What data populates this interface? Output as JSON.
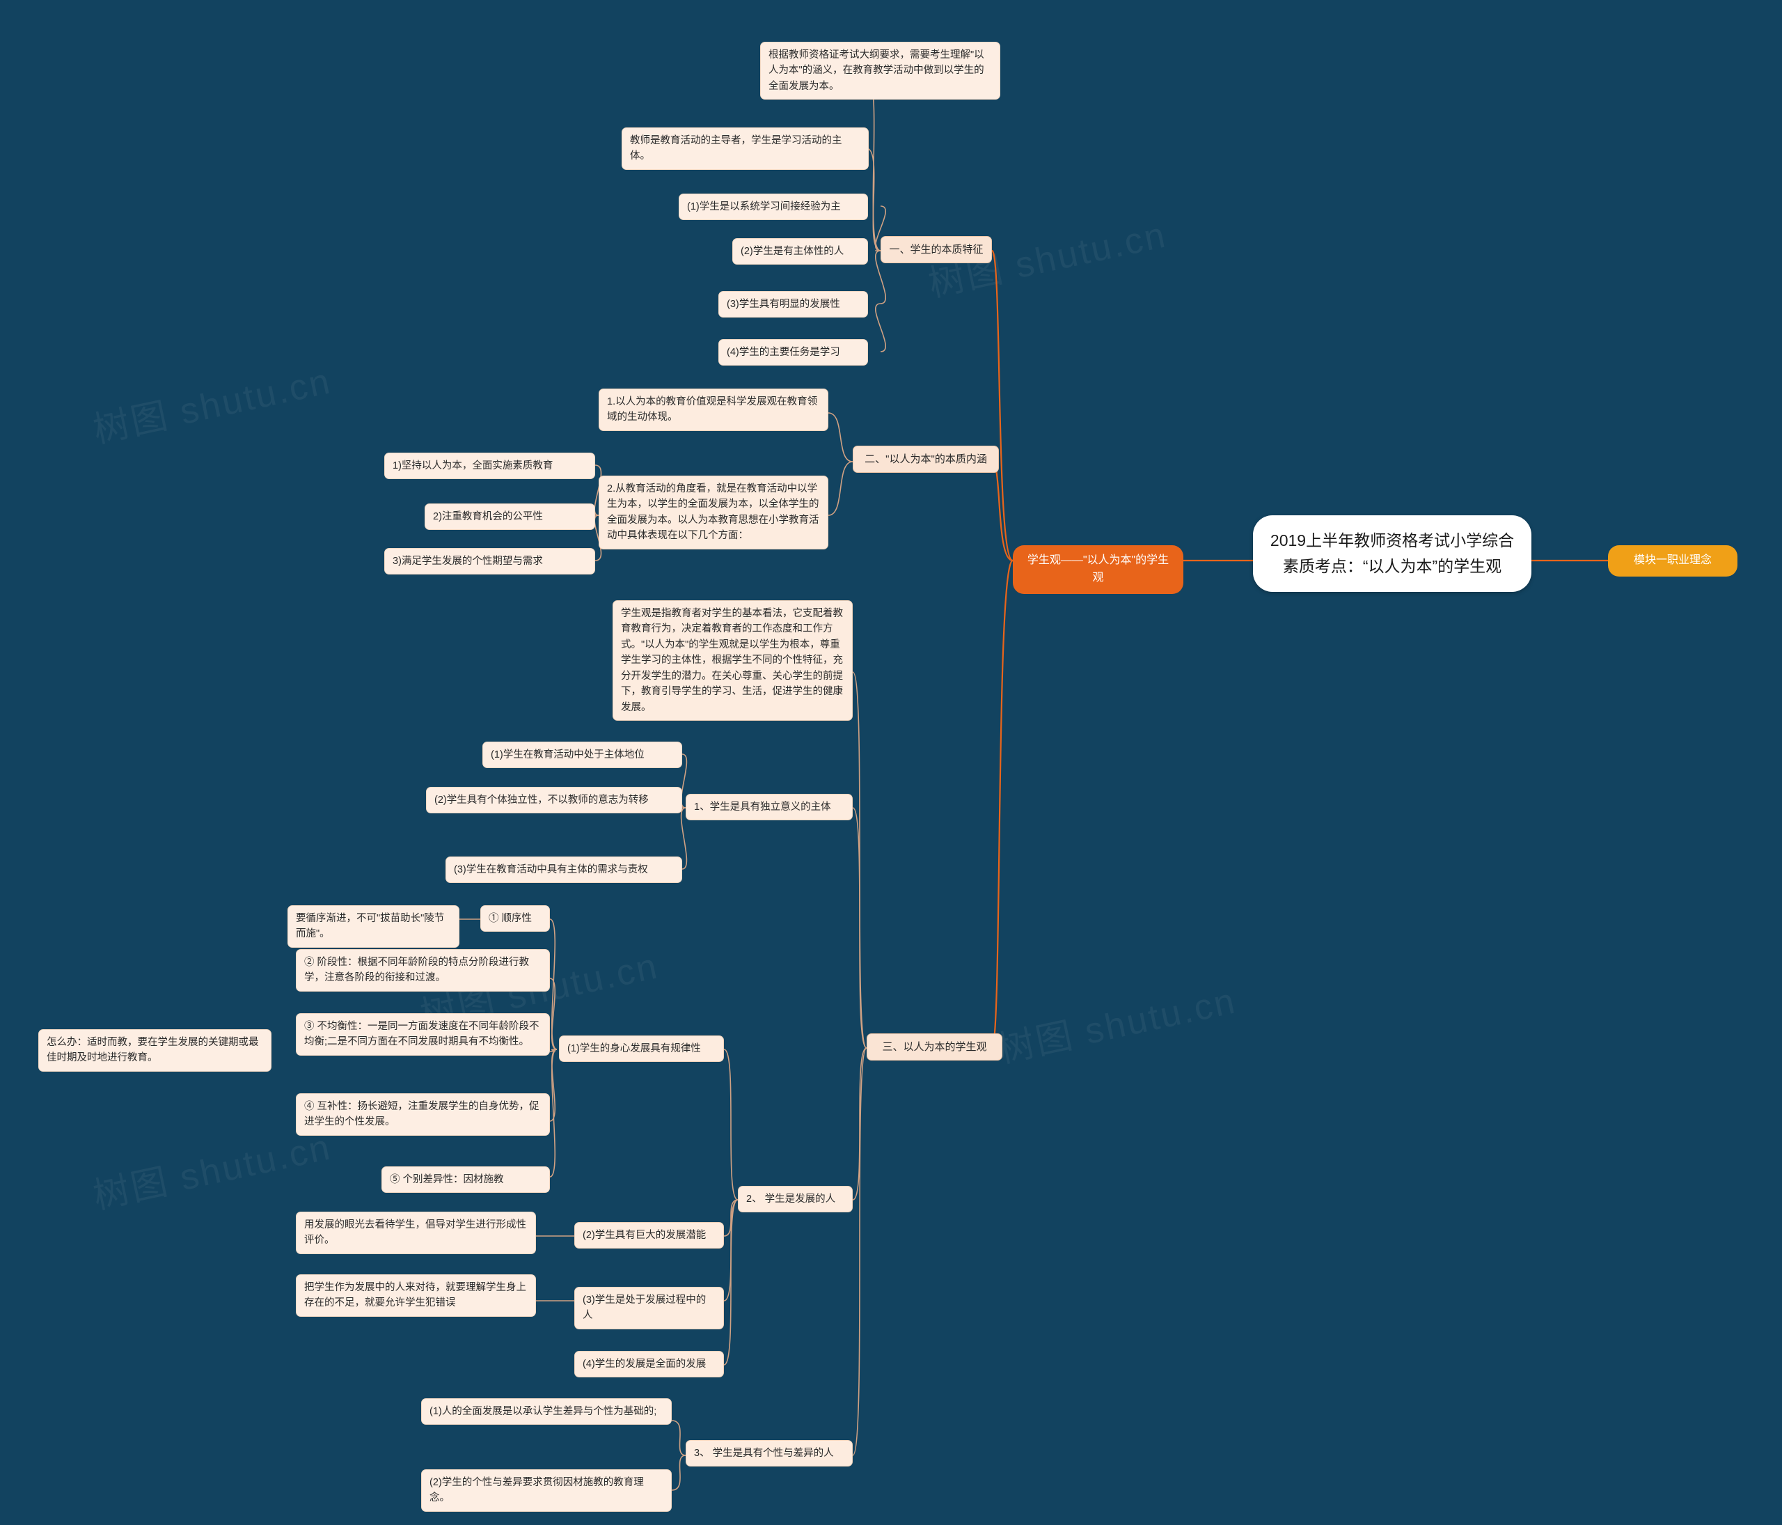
{
  "meta": {
    "background_color": "#124360",
    "node_fill": "#fae4d4",
    "accent_orange": "#e8641a",
    "accent_yellow": "#f0a017",
    "watermark_text": "树图 shutu.cn"
  },
  "center": {
    "title": "2019上半年教师资格考试小学综合素质考点：“以人为本”的学生观"
  },
  "root_right": {
    "label": "模块一职业理念"
  },
  "root_left": {
    "label": "学生观——\"以人为本\"的学生观"
  },
  "branches": [
    {
      "id": "b1",
      "label": "一、学生的本质特征",
      "children": [
        {
          "label": "根据教师资格证考试大纲要求，需要考生理解\"以人为本\"的涵义，在教育教学活动中做到以学生的全面发展为本。"
        },
        {
          "label": "教师是教育活动的主导者，学生是学习活动的主体。"
        },
        {
          "label": "(1)学生是以系统学习间接经验为主"
        },
        {
          "label": "(2)学生是有主体性的人"
        },
        {
          "label": "(3)学生具有明显的发展性"
        },
        {
          "label": "(4)学生的主要任务是学习"
        }
      ]
    },
    {
      "id": "b2",
      "label": "二、\"以人为本\"的本质内涵",
      "children": [
        {
          "label": "1.以人为本的教育价值观是科学发展观在教育领域的生动体现。"
        },
        {
          "label": "2.从教育活动的角度看，就是在教育活动中以学生为本，以学生的全面发展为本，以全体学生的全面发展为本。以人为本教育思想在小学教育活动中具体表现在以下几个方面：",
          "children": [
            {
              "label": "1)坚持以人为本，全面实施素质教育"
            },
            {
              "label": "2)注重教育机会的公平性"
            },
            {
              "label": "3)满足学生发展的个性期望与需求"
            }
          ]
        }
      ]
    },
    {
      "id": "b3",
      "label": "三、以人为本的学生观",
      "intro": "学生观是指教育者对学生的基本看法，它支配着教育教育行为，决定着教育者的工作态度和工作方式。\"以人为本\"的学生观就是以学生为根本，尊重学生学习的主体性，根据学生不同的个性特征，充分开发学生的潜力。在关心尊重、关心学生的前提下，教育引导学生的学习、生活，促进学生的健康发展。",
      "children": [
        {
          "label": "1、学生是具有独立意义的主体",
          "children": [
            {
              "label": "(1)学生在教育活动中处于主体地位"
            },
            {
              "label": "(2)学生具有个体独立性，不以教师的意志为转移"
            },
            {
              "label": "(3)学生在教育活动中具有主体的需求与责权"
            }
          ]
        },
        {
          "label": "2、 学生是发展的人",
          "children": [
            {
              "label": "(1)学生的身心发展具有规律性",
              "children": [
                {
                  "label": "① 顺序性",
                  "children": [
                    {
                      "label": "要循序渐进，不可\"拔苗助长\"陵节而施\"。"
                    }
                  ]
                },
                {
                  "label": "② 阶段性：根据不同年龄阶段的特点分阶段进行教学，注意各阶段的衔接和过渡。"
                },
                {
                  "label": "③ 不均衡性：一是同一方面发速度在不同年龄阶段不均衡;二是不同方面在不同发展时期具有不均衡性。",
                  "children": [
                    {
                      "label": "怎么办：适时而教，要在学生发展的关键期或最佳时期及时地进行教育。"
                    }
                  ]
                },
                {
                  "label": "④ 互补性：扬长避短，注重发展学生的自身优势，促进学生的个性发展。"
                },
                {
                  "label": "⑤ 个别差异性：因材施教"
                }
              ]
            },
            {
              "label": "(2)学生具有巨大的发展潜能",
              "children": [
                {
                  "label": "用发展的眼光去看待学生，倡导对学生进行形成性评价。"
                }
              ]
            },
            {
              "label": "(3)学生是处于发展过程中的人",
              "children": [
                {
                  "label": "把学生作为发展中的人来对待，就要理解学生身上存在的不足，就要允许学生犯错误"
                }
              ]
            },
            {
              "label": "(4)学生的发展是全面的发展"
            }
          ]
        },
        {
          "label": "3、 学生是具有个性与差异的人",
          "children": [
            {
              "label": "(1)人的全面发展是以承认学生差异与个性为基础的;"
            },
            {
              "label": "(2)学生的个性与差异要求贯彻因材施教的教育理念。"
            }
          ]
        }
      ]
    }
  ]
}
